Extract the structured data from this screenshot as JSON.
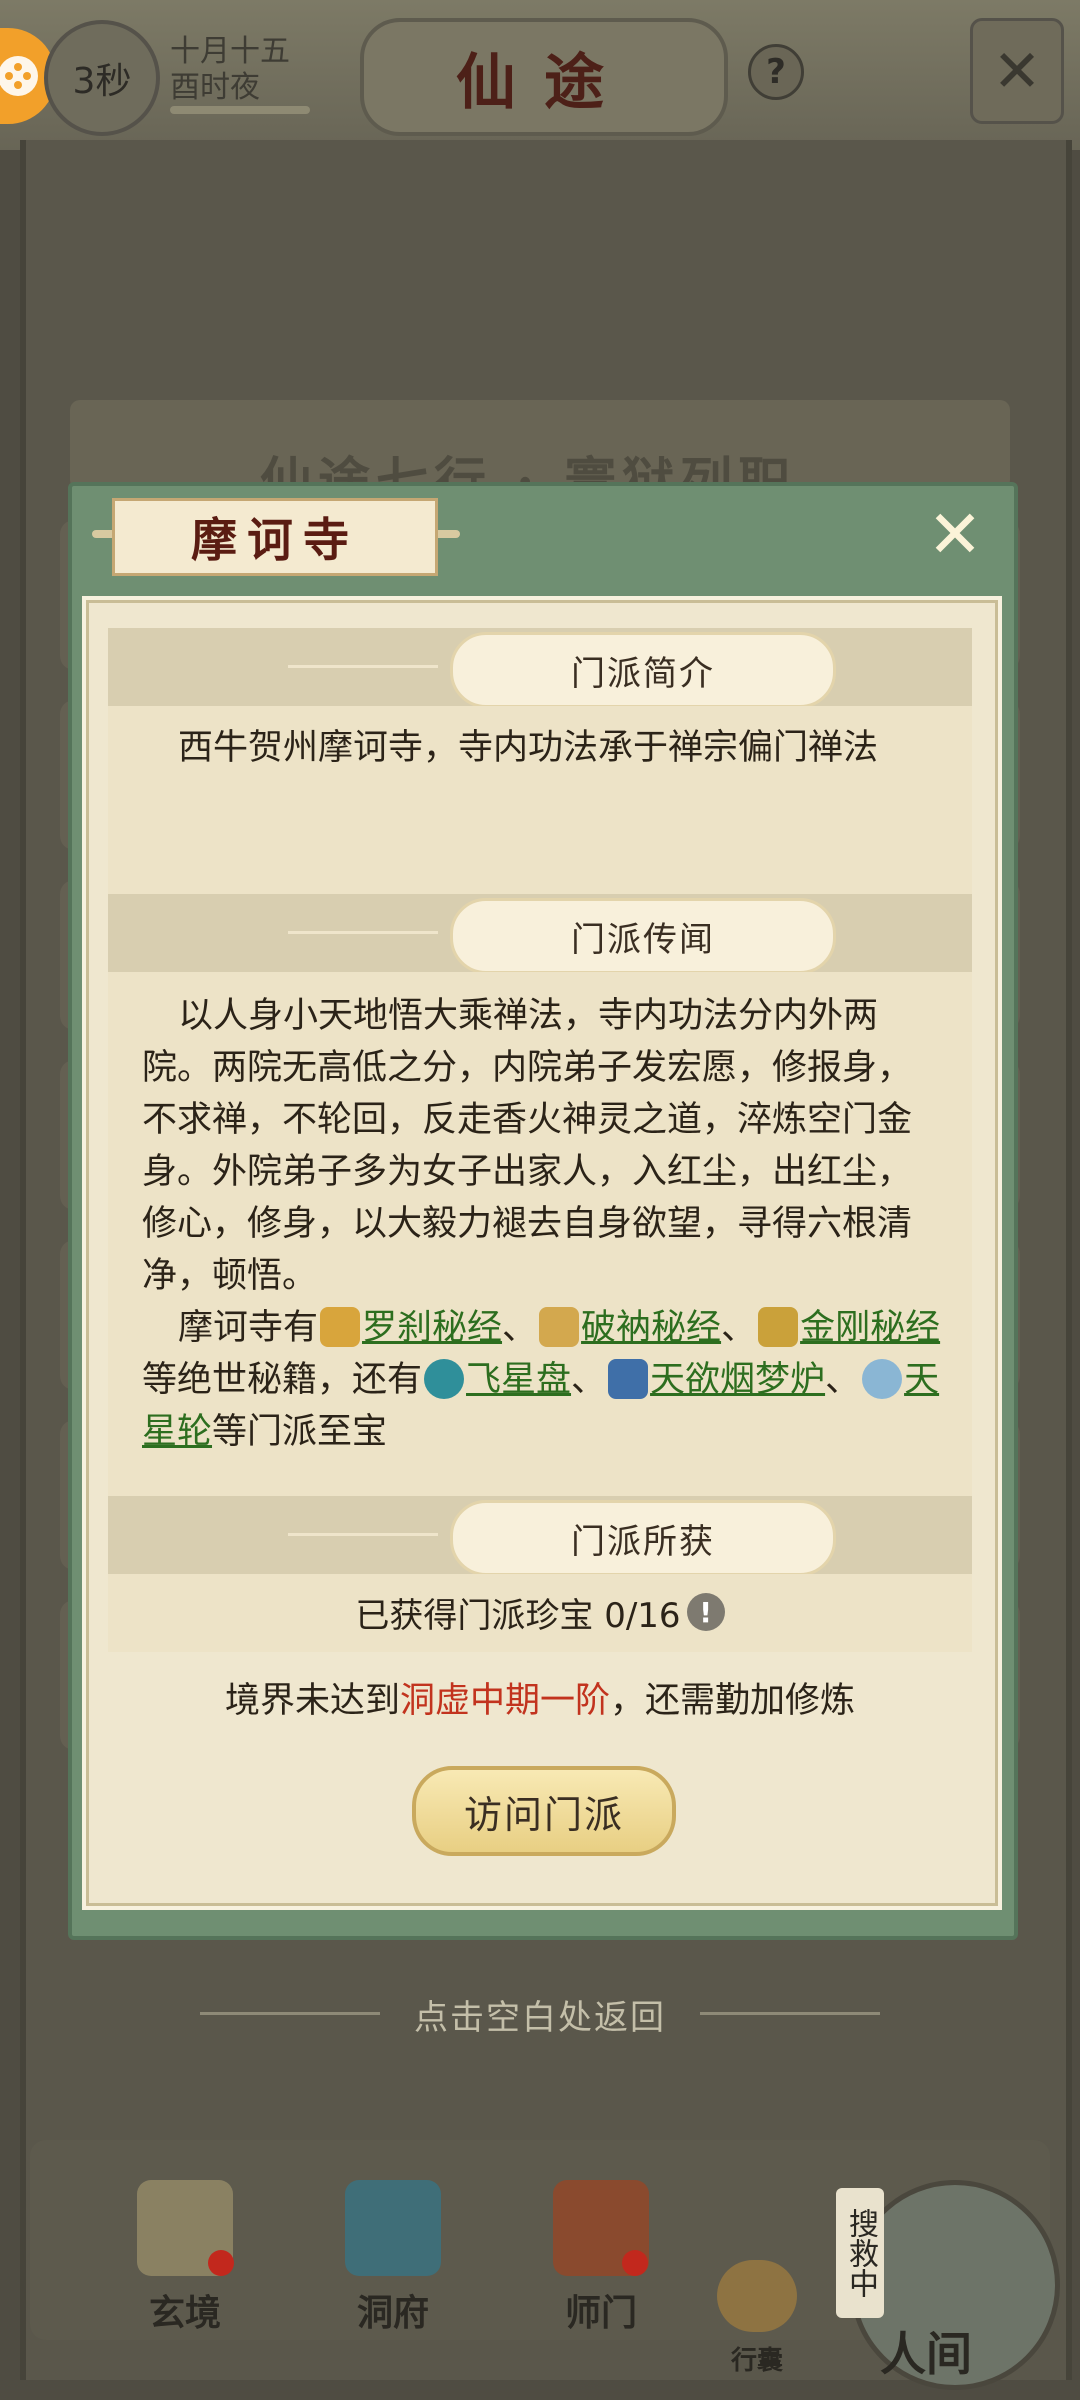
{
  "topbar": {
    "timer_label": "3秒",
    "date_line1": "十月十五",
    "date_line2": "酉时夜",
    "game_title": "仙途",
    "help_icon": "?"
  },
  "background": {
    "header_title": "仙途七行 · 寰狱列职"
  },
  "modal": {
    "title": "摩诃寺",
    "sections": {
      "intro": {
        "heading": "门派简介",
        "text": "西牛贺州摩诃寺，寺内功法承于禅宗偏门禅法"
      },
      "lore": {
        "heading": "门派传闻",
        "paragraph1": "以人身小天地悟大乘禅法，寺内功法分内外两院。两院无高低之分，内院弟子发宏愿，修报身，不求禅，不轮回，反走香火神灵之道，淬炼空门金身。外院弟子多为女子出家人，入红尘，出红尘，修心，修身，以大毅力褪去自身欲望，寻得六根清净，顿悟。",
        "p2_prefix": "摩诃寺有",
        "scripture1": "罗刹秘经",
        "sep1": "、",
        "scripture2": "破衲秘经",
        "sep2": "、",
        "scripture3": "金刚秘经",
        "p2_middle": "等绝世秘籍，还有",
        "treasure1": "飞星盘",
        "sep3": "、",
        "treasure2": "天欲烟梦炉",
        "sep4": "、",
        "treasure3": "天星轮",
        "p2_suffix": "等门派至宝"
      },
      "acquired": {
        "heading": "门派所获",
        "text": "已获得门派珍宝 0/16"
      }
    },
    "realm_note_prefix": "境界未达到",
    "realm_note_highlight": "洞虚中期一阶",
    "realm_note_suffix": "，还需勤加修炼",
    "visit_button": "访问门派"
  },
  "bottom_hint": "点击空白处返回",
  "nav": {
    "items": [
      "玄境",
      "洞府",
      "师门",
      "行囊"
    ],
    "search_tag": "搜救中",
    "world_label": "人间"
  },
  "colors": {
    "link_green": "#2d6e1f",
    "highlight_red": "#c2331e",
    "modal_green": "#6f8f72"
  }
}
